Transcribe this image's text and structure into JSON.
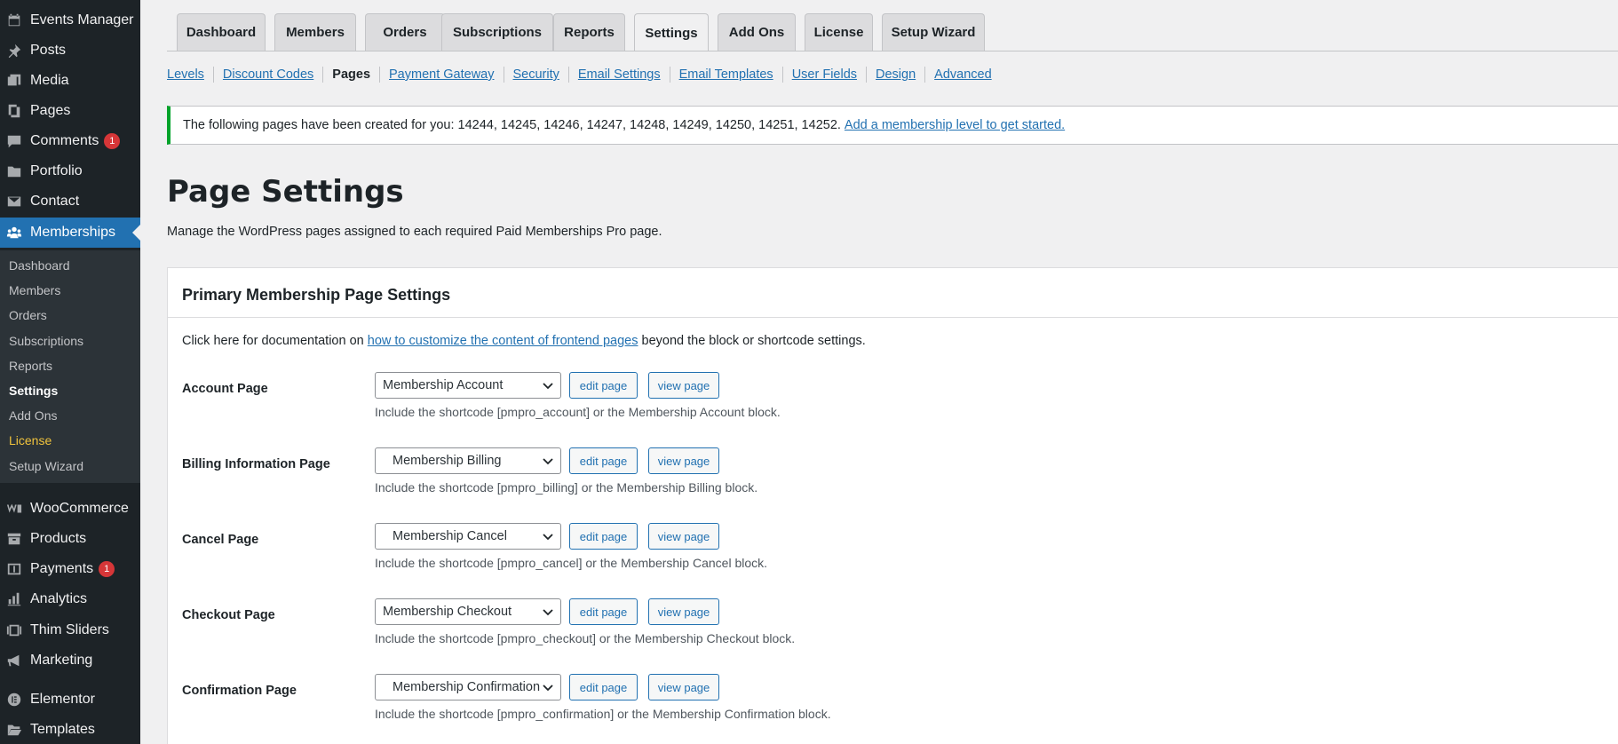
{
  "sidebar": {
    "items": [
      {
        "label": "Events Manager",
        "icon": "calendar-icon"
      },
      {
        "label": "Posts",
        "icon": "pin-icon"
      },
      {
        "label": "Media",
        "icon": "media-icon"
      },
      {
        "label": "Pages",
        "icon": "pages-icon"
      },
      {
        "label": "Comments",
        "icon": "comments-icon",
        "badge": "1"
      },
      {
        "label": "Portfolio",
        "icon": "folder-icon"
      },
      {
        "label": "Contact",
        "icon": "mail-icon"
      },
      {
        "label": "Memberships",
        "icon": "groups-icon"
      },
      {
        "label": "WooCommerce",
        "icon": "woocommerce-icon"
      },
      {
        "label": "Products",
        "icon": "archive-icon"
      },
      {
        "label": "Payments",
        "icon": "dollar-icon",
        "badge": "1"
      },
      {
        "label": "Analytics",
        "icon": "bar-chart-icon"
      },
      {
        "label": "Thim Sliders",
        "icon": "slides-icon"
      },
      {
        "label": "Marketing",
        "icon": "megaphone-icon"
      },
      {
        "label": "Elementor",
        "icon": "elementor-icon"
      },
      {
        "label": "Templates",
        "icon": "folder-open-icon"
      }
    ],
    "submenu": [
      "Dashboard",
      "Members",
      "Orders",
      "Subscriptions",
      "Reports",
      "Settings",
      "Add Ons",
      "License",
      "Setup Wizard"
    ]
  },
  "tabs": [
    "Dashboard",
    "Members",
    "Orders",
    "Subscriptions",
    "Reports",
    "Settings",
    "Add Ons",
    "License",
    "Setup Wizard"
  ],
  "subnav": [
    "Levels",
    "Discount Codes",
    "Pages",
    "Payment Gateway",
    "Security",
    "Email Settings",
    "Email Templates",
    "User Fields",
    "Design",
    "Advanced"
  ],
  "notice": {
    "text": "The following pages have been created for you: 14244, 14245, 14246, 14247, 14248, 14249, 14250, 14251, 14252.",
    "link": "Add a membership level to get started."
  },
  "page": {
    "title": "Page Settings",
    "description": "Manage the WordPress pages assigned to each required Paid Memberships Pro page."
  },
  "panel": {
    "title": "Primary Membership Page Settings",
    "doc_prefix": "Click here for documentation on",
    "doc_link": "how to customize the content of frontend pages",
    "doc_suffix": "beyond the block or shortcode settings."
  },
  "buttons": {
    "edit": "edit page",
    "view": "view page"
  },
  "rows": [
    {
      "label": "Account Page",
      "selected": "Membership Account",
      "help": "Include the shortcode [pmpro_account] or the Membership Account block."
    },
    {
      "label": "Billing Information Page",
      "selected": "Membership Billing",
      "help": "Include the shortcode [pmpro_billing] or the Membership Billing block."
    },
    {
      "label": "Cancel Page",
      "selected": "Membership Cancel",
      "help": "Include the shortcode [pmpro_cancel] or the Membership Cancel block."
    },
    {
      "label": "Checkout Page",
      "selected": "Membership Checkout",
      "help": "Include the shortcode [pmpro_checkout] or the Membership Checkout block."
    },
    {
      "label": "Confirmation Page",
      "selected": "Membership Confirmation",
      "help": "Include the shortcode [pmpro_confirmation] or the Membership Confirmation block."
    }
  ],
  "colors": {
    "sidebar_bg": "#1d2327",
    "accent": "#2271b1",
    "notice_success": "#00a32a",
    "badge": "#d63638",
    "license": "#f0c33c"
  }
}
